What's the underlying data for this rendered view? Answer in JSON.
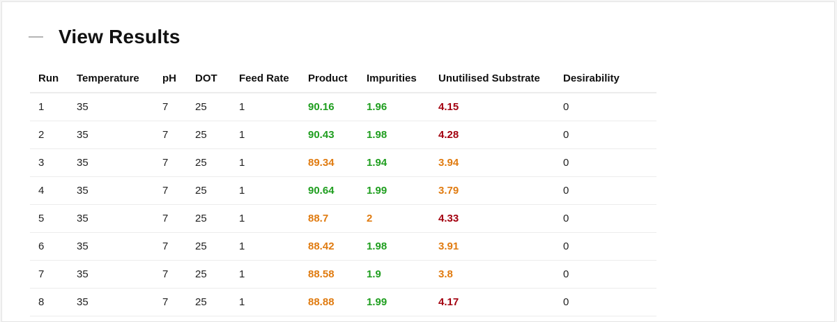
{
  "section": {
    "title": "View Results"
  },
  "colors": {
    "green": "#1f9e1f",
    "orange": "#e07b10",
    "red": "#a3000f"
  },
  "table": {
    "columns": [
      "Run",
      "Temperature",
      "pH",
      "DOT",
      "Feed Rate",
      "Product",
      "Impurities",
      "Unutilised Substrate",
      "Desirability"
    ],
    "rows": [
      {
        "run": "1",
        "temperature": "35",
        "ph": "7",
        "dot": "25",
        "feed_rate": "1",
        "product": "90.16",
        "product_status": "green",
        "impurities": "1.96",
        "impurities_status": "green",
        "substrate": "4.15",
        "substrate_status": "red",
        "desirability": "0"
      },
      {
        "run": "2",
        "temperature": "35",
        "ph": "7",
        "dot": "25",
        "feed_rate": "1",
        "product": "90.43",
        "product_status": "green",
        "impurities": "1.98",
        "impurities_status": "green",
        "substrate": "4.28",
        "substrate_status": "red",
        "desirability": "0"
      },
      {
        "run": "3",
        "temperature": "35",
        "ph": "7",
        "dot": "25",
        "feed_rate": "1",
        "product": "89.34",
        "product_status": "orange",
        "impurities": "1.94",
        "impurities_status": "green",
        "substrate": "3.94",
        "substrate_status": "orange",
        "desirability": "0"
      },
      {
        "run": "4",
        "temperature": "35",
        "ph": "7",
        "dot": "25",
        "feed_rate": "1",
        "product": "90.64",
        "product_status": "green",
        "impurities": "1.99",
        "impurities_status": "green",
        "substrate": "3.79",
        "substrate_status": "orange",
        "desirability": "0"
      },
      {
        "run": "5",
        "temperature": "35",
        "ph": "7",
        "dot": "25",
        "feed_rate": "1",
        "product": "88.7",
        "product_status": "orange",
        "impurities": "2",
        "impurities_status": "orange",
        "substrate": "4.33",
        "substrate_status": "red",
        "desirability": "0"
      },
      {
        "run": "6",
        "temperature": "35",
        "ph": "7",
        "dot": "25",
        "feed_rate": "1",
        "product": "88.42",
        "product_status": "orange",
        "impurities": "1.98",
        "impurities_status": "green",
        "substrate": "3.91",
        "substrate_status": "orange",
        "desirability": "0"
      },
      {
        "run": "7",
        "temperature": "35",
        "ph": "7",
        "dot": "25",
        "feed_rate": "1",
        "product": "88.58",
        "product_status": "orange",
        "impurities": "1.9",
        "impurities_status": "green",
        "substrate": "3.8",
        "substrate_status": "orange",
        "desirability": "0"
      },
      {
        "run": "8",
        "temperature": "35",
        "ph": "7",
        "dot": "25",
        "feed_rate": "1",
        "product": "88.88",
        "product_status": "orange",
        "impurities": "1.99",
        "impurities_status": "green",
        "substrate": "4.17",
        "substrate_status": "red",
        "desirability": "0"
      }
    ]
  }
}
